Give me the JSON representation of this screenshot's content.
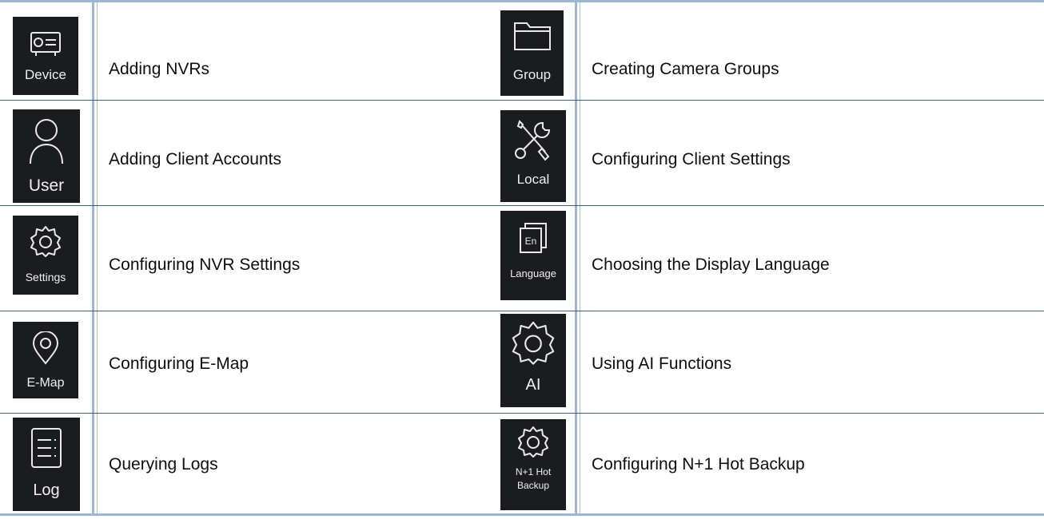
{
  "rows": [
    {
      "left": {
        "icon": "device-icon",
        "icon_label": "Device",
        "text": "Adding NVRs"
      },
      "right": {
        "icon": "folder-icon",
        "icon_label": "Group",
        "text": "Creating Camera Groups"
      }
    },
    {
      "left": {
        "icon": "user-icon",
        "icon_label": "User",
        "text": "Adding Client Accounts"
      },
      "right": {
        "icon": "tools-icon",
        "icon_label": "Local",
        "text": "Configuring Client Settings"
      }
    },
    {
      "left": {
        "icon": "gear-icon",
        "icon_label": "Settings",
        "text": "Configuring NVR Settings"
      },
      "right": {
        "icon": "language-icon",
        "icon_label": "Language",
        "text": "Choosing the Display Language"
      }
    },
    {
      "left": {
        "icon": "map-pin-icon",
        "icon_label": "E-Map",
        "text": "Configuring E-Map"
      },
      "right": {
        "icon": "gear-icon",
        "icon_label": "AI",
        "text": "Using AI Functions"
      }
    },
    {
      "left": {
        "icon": "log-list-icon",
        "icon_label": "Log",
        "text": "Querying Logs"
      },
      "right": {
        "icon": "gear-icon",
        "icon_label_line1": "N+1 Hot",
        "icon_label_line2": "Backup",
        "text": "Configuring N+1 Hot Backup"
      }
    }
  ],
  "colors": {
    "rule": "#9eb6d6",
    "row_separator": "#3a5f8a",
    "icon_background": "#1b1c1f",
    "icon_foreground": "#e9e9e9",
    "text": "#0d0d0d"
  }
}
